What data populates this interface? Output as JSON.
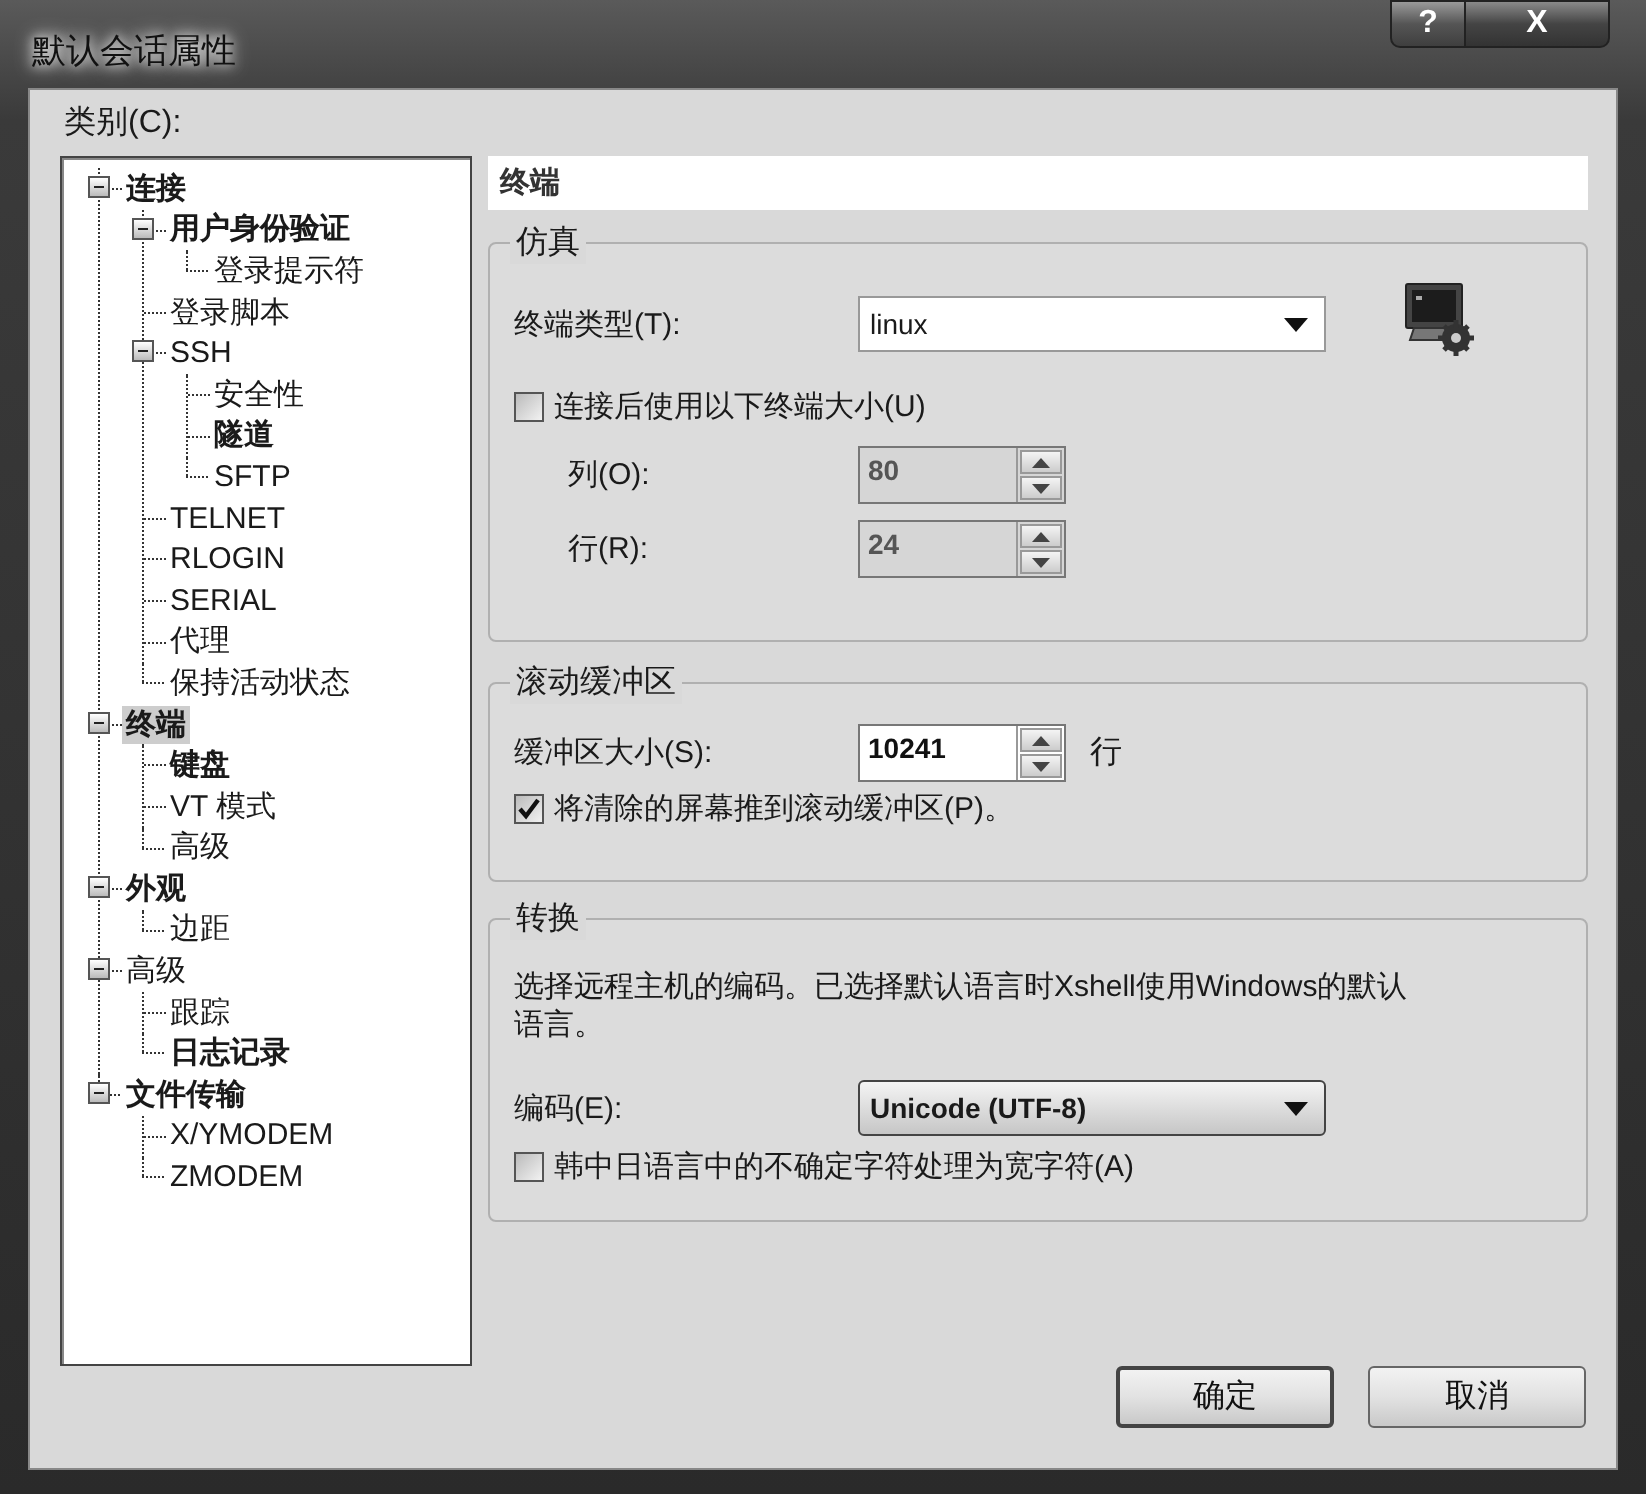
{
  "window": {
    "title": "默认会话属性",
    "help_button": "?",
    "close_button": "X"
  },
  "category_label": "类别(C):",
  "tree": [
    {
      "label": "连接",
      "bold": true,
      "selected": false,
      "expanded": true,
      "children": [
        {
          "label": "用户身份验证",
          "bold": true,
          "selected": false,
          "expanded": true,
          "children": [
            {
              "label": "登录提示符",
              "bold": false,
              "selected": false
            }
          ]
        },
        {
          "label": "登录脚本",
          "bold": false,
          "selected": false
        },
        {
          "label": "SSH",
          "bold": false,
          "selected": false,
          "expanded": true,
          "children": [
            {
              "label": "安全性",
              "bold": false,
              "selected": false
            },
            {
              "label": "隧道",
              "bold": true,
              "selected": false
            },
            {
              "label": "SFTP",
              "bold": false,
              "selected": false
            }
          ]
        },
        {
          "label": "TELNET",
          "bold": false,
          "selected": false
        },
        {
          "label": "RLOGIN",
          "bold": false,
          "selected": false
        },
        {
          "label": "SERIAL",
          "bold": false,
          "selected": false
        },
        {
          "label": "代理",
          "bold": false,
          "selected": false
        },
        {
          "label": "保持活动状态",
          "bold": false,
          "selected": false
        }
      ]
    },
    {
      "label": "终端",
      "bold": true,
      "selected": true,
      "expanded": true,
      "children": [
        {
          "label": "键盘",
          "bold": true,
          "selected": false
        },
        {
          "label": "VT 模式",
          "bold": false,
          "selected": false
        },
        {
          "label": "高级",
          "bold": false,
          "selected": false
        }
      ]
    },
    {
      "label": "外观",
      "bold": true,
      "selected": false,
      "expanded": true,
      "children": [
        {
          "label": "边距",
          "bold": false,
          "selected": false
        }
      ]
    },
    {
      "label": "高级",
      "bold": false,
      "selected": false,
      "expanded": true,
      "children": [
        {
          "label": "跟踪",
          "bold": false,
          "selected": false
        },
        {
          "label": "日志记录",
          "bold": true,
          "selected": false
        }
      ]
    },
    {
      "label": "文件传输",
      "bold": true,
      "selected": false,
      "expanded": true,
      "children": [
        {
          "label": "X/YMODEM",
          "bold": false,
          "selected": false
        },
        {
          "label": "ZMODEM",
          "bold": false,
          "selected": false
        }
      ]
    }
  ],
  "panel_title": "终端",
  "emulation": {
    "title": "仿真",
    "terminal_type": {
      "label": "终端类型(T):",
      "value": "linux"
    },
    "use_size": {
      "label": "连接后使用以下终端大小(U)",
      "checked": false
    },
    "columns": {
      "label": "列(O):",
      "value": "80",
      "disabled": true
    },
    "rows": {
      "label": "行(R):",
      "value": "24",
      "disabled": true
    }
  },
  "scrollback": {
    "title": "滚动缓冲区",
    "size": {
      "label": "缓冲区大小(S):",
      "value": "10241",
      "disabled": false,
      "unit": "行"
    },
    "push": {
      "label": "将清除的屏幕推到滚动缓冲区(P)。",
      "checked": true
    }
  },
  "translation": {
    "title": "转换",
    "description": "选择远程主机的编码。已选择默认语言时Xshell使用Windows的默认语言。",
    "encoding": {
      "label": "编码(E):",
      "value": "Unicode (UTF-8)"
    },
    "cjk": {
      "label": "韩中日语言中的不确定字符处理为宽字符(A)",
      "checked": false
    }
  },
  "buttons": [
    {
      "label": "确定",
      "default": true
    },
    {
      "label": "取消",
      "default": false
    }
  ]
}
